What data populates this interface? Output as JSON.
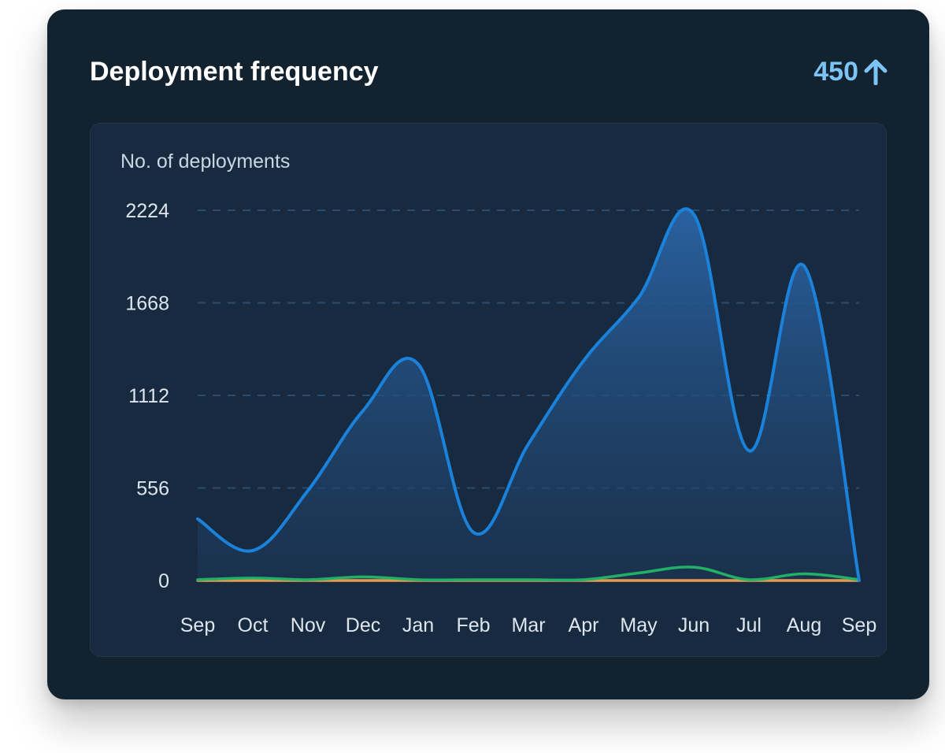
{
  "card": {
    "title": "Deployment frequency",
    "metric_value": "450",
    "metric_icon": "arrow-up-icon"
  },
  "chart_data": {
    "type": "area",
    "title": "Deployment frequency",
    "xlabel": "",
    "ylabel": "No. of deployments",
    "categories": [
      "Sep",
      "Oct",
      "Nov",
      "Dec",
      "Jan",
      "Feb",
      "Mar",
      "Apr",
      "May",
      "Jun",
      "Jul",
      "Aug",
      "Sep"
    ],
    "yticks": [
      "2224",
      "1668",
      "1112",
      "556",
      "0"
    ],
    "ylim": [
      0,
      2224
    ],
    "grid": true,
    "series": [
      {
        "color": "#1b82dc",
        "fill": true,
        "values": [
          370,
          180,
          540,
          1020,
          1300,
          290,
          820,
          1320,
          1700,
          2200,
          780,
          1890,
          0
        ]
      },
      {
        "color": "#21b066",
        "fill": false,
        "values": [
          5,
          15,
          5,
          22,
          5,
          5,
          5,
          5,
          45,
          80,
          5,
          40,
          5
        ]
      },
      {
        "color": "#e59a54",
        "fill": false,
        "values": [
          0,
          0,
          0,
          0,
          0,
          0,
          0,
          0,
          0,
          0,
          0,
          0,
          0
        ]
      }
    ]
  }
}
